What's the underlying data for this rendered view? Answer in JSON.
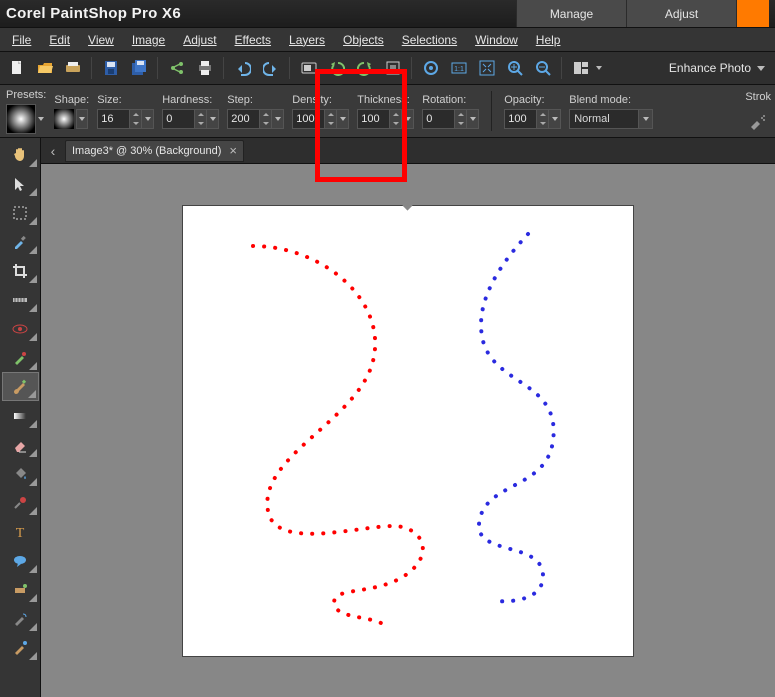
{
  "app_title": "Corel PaintShop Pro X6",
  "top_tabs": {
    "manage": "Manage",
    "adjust": "Adjust"
  },
  "menu": {
    "file": "File",
    "edit": "Edit",
    "view": "View",
    "image": "Image",
    "adjust": "Adjust",
    "effects": "Effects",
    "layers": "Layers",
    "objects": "Objects",
    "selections": "Selections",
    "window": "Window",
    "help": "Help"
  },
  "enhance_label": "Enhance Photo",
  "opts": {
    "presets_label": "Presets:",
    "shape_label": "Shape:",
    "size_label": "Size:",
    "size_value": "16",
    "hardness_label": "Hardness:",
    "hardness_value": "0",
    "step_label": "Step:",
    "step_value": "200",
    "density_label": "Density:",
    "density_value": "100",
    "thickness_label": "Thickness:",
    "thickness_value": "100",
    "rotation_label": "Rotation:",
    "rotation_value": "0",
    "opacity_label": "Opacity:",
    "opacity_value": "100",
    "blend_label": "Blend mode:",
    "blend_value": "Normal",
    "stroke_label": "Strok"
  },
  "doc_tab": "Image3*  @  30% (Background)",
  "colors": {
    "accent_orange": "#ff7a00",
    "highlight": "#ff0000"
  }
}
